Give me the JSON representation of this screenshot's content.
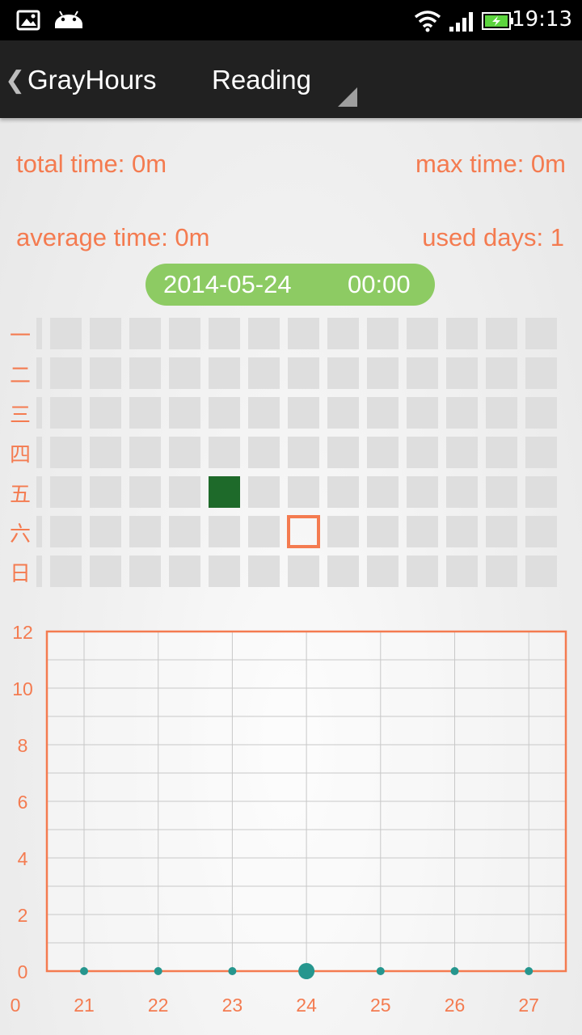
{
  "status_bar": {
    "time": "19:13",
    "icons": [
      "image-icon",
      "android-icon",
      "wifi-icon",
      "signal-icon",
      "battery-charging-icon"
    ]
  },
  "action_bar": {
    "back_icon": "chevron-left-icon",
    "app_title": "GrayHours",
    "category_selected": "Reading"
  },
  "stats": {
    "total_time": "total time: 0m",
    "max_time": "max time: 0m",
    "average_time": "average time: 0m",
    "used_days": "used days: 1"
  },
  "selected_date": {
    "date": "2014-05-24",
    "time": "00:00"
  },
  "calendar": {
    "weekday_labels": [
      "一",
      "二",
      "三",
      "四",
      "五",
      "六",
      "日"
    ],
    "active_cell": {
      "week": 4,
      "weekday": 4
    },
    "selected_cell": {
      "week": 6,
      "weekday": 5
    },
    "colors": {
      "empty": "#dedede",
      "active": "#1e6a2a",
      "selected_border": "#f47b50"
    }
  },
  "chart_data": {
    "type": "line",
    "title": "",
    "xlabel": "",
    "ylabel": "",
    "x": [
      21,
      22,
      23,
      24,
      25,
      26,
      27
    ],
    "series": [
      {
        "values": [
          0,
          0,
          0,
          0,
          0,
          0,
          0
        ]
      }
    ],
    "highlight_x": 24,
    "origin_label": "0",
    "ylim": [
      0,
      12
    ],
    "y_ticks": [
      0,
      2,
      4,
      6,
      8,
      10,
      12
    ],
    "grid": true,
    "colors": {
      "axis": "#f47b50",
      "point": "#26968e",
      "grid": "#c8c8c8"
    }
  },
  "colors": {
    "accent": "#f47b50",
    "pill": "#8dcb63",
    "action_bar": "#212121"
  }
}
